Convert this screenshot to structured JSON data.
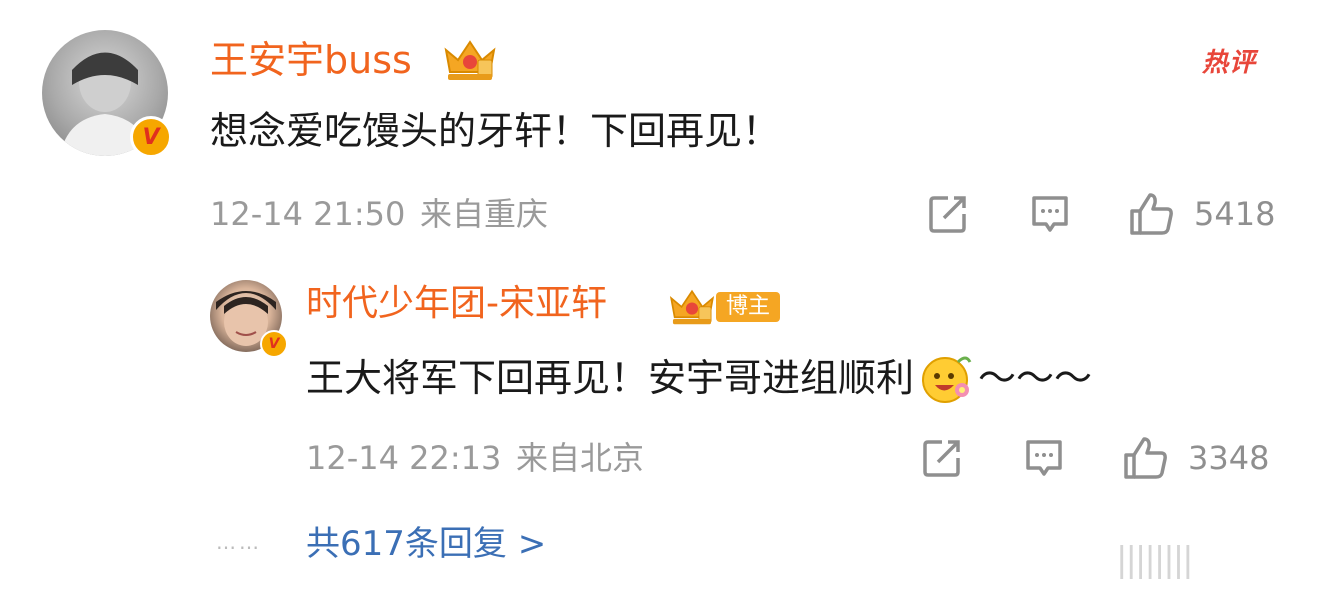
{
  "comment": {
    "author": "王安宇buss",
    "hot_label": "热评",
    "text": "想念爱吃馒头的牙轩！下回再见！",
    "timestamp": "12-14 21:50",
    "location": "来自重庆",
    "like_count": "5418",
    "verified_badge": "V"
  },
  "reply": {
    "author": "时代少年团-宋亚轩",
    "role_badge": "博主",
    "text": "王大将军下回再见！安宇哥进组顺利",
    "tilde": "～～～",
    "timestamp": "12-14 22:13",
    "location": "来自北京",
    "like_count": "3348",
    "verified_badge": "V"
  },
  "replies_link": "共617条回复 >",
  "dots": "……",
  "watermark": "||||||||",
  "colors": {
    "username": "#f1641e",
    "link": "#3b6fb5",
    "meta": "#9a9a9a",
    "hot": "#e8463a",
    "badge": "#f5a623"
  },
  "icons": [
    "share-icon",
    "comment-icon",
    "like-icon",
    "crown-icon",
    "emoji-icon"
  ]
}
